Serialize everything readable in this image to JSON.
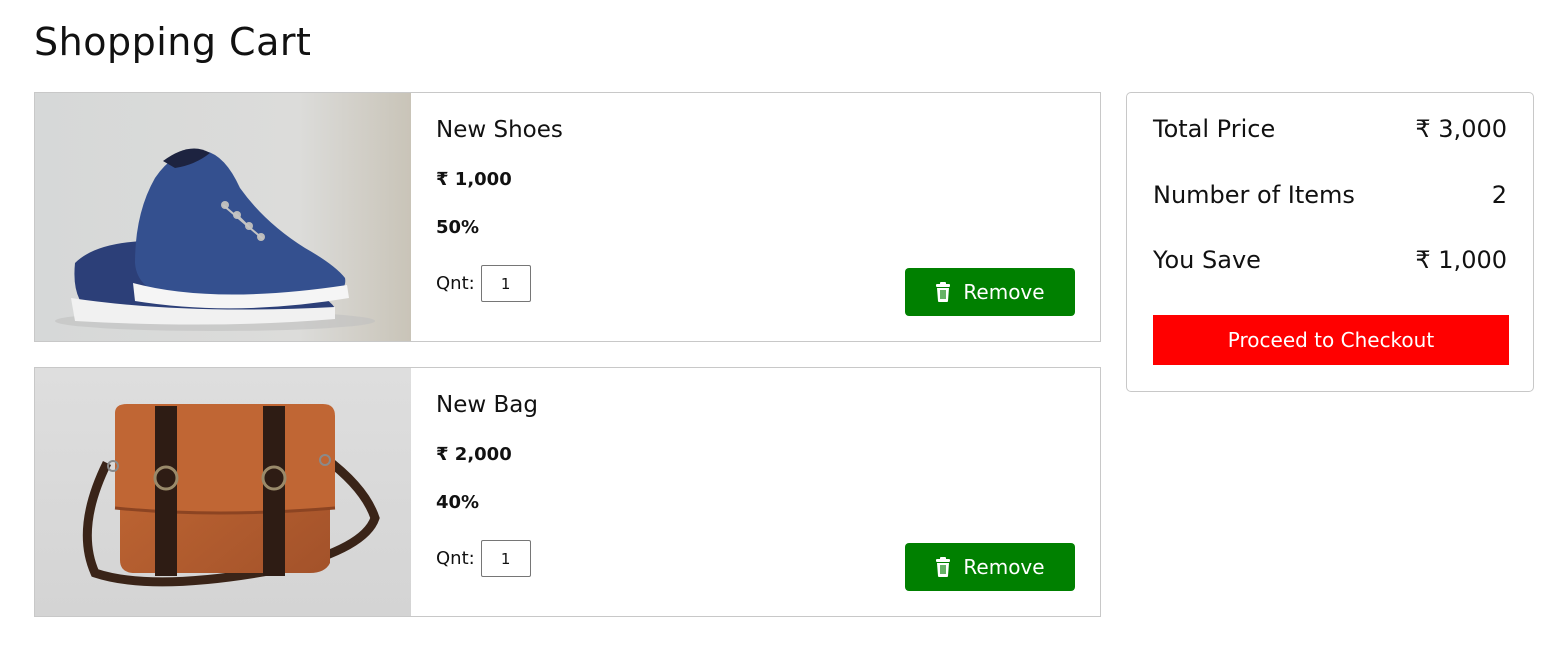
{
  "page": {
    "title": "Shopping Cart"
  },
  "cart": {
    "items": [
      {
        "name": "New Shoes",
        "price": "₹ 1,000",
        "discount": "50%",
        "qty_label": "Qnt:",
        "qty_value": "1",
        "remove_label": "Remove",
        "image": "blue-canvas-shoes-photo"
      },
      {
        "name": "New Bag",
        "price": "₹ 2,000",
        "discount": "40%",
        "qty_label": "Qnt:",
        "qty_value": "1",
        "remove_label": "Remove",
        "image": "brown-leather-bag-photo"
      }
    ]
  },
  "summary": {
    "rows": [
      {
        "label": "Total Price",
        "value": "₹ 3,000"
      },
      {
        "label": "Number of Items",
        "value": "2"
      },
      {
        "label": "You Save",
        "value": "₹ 1,000"
      }
    ],
    "checkout_label": "Proceed to Checkout"
  },
  "colors": {
    "remove_button": "#008000",
    "checkout_button": "#ff0000",
    "border": "#c8c8c8"
  },
  "icons": {
    "remove": "trash-icon"
  }
}
